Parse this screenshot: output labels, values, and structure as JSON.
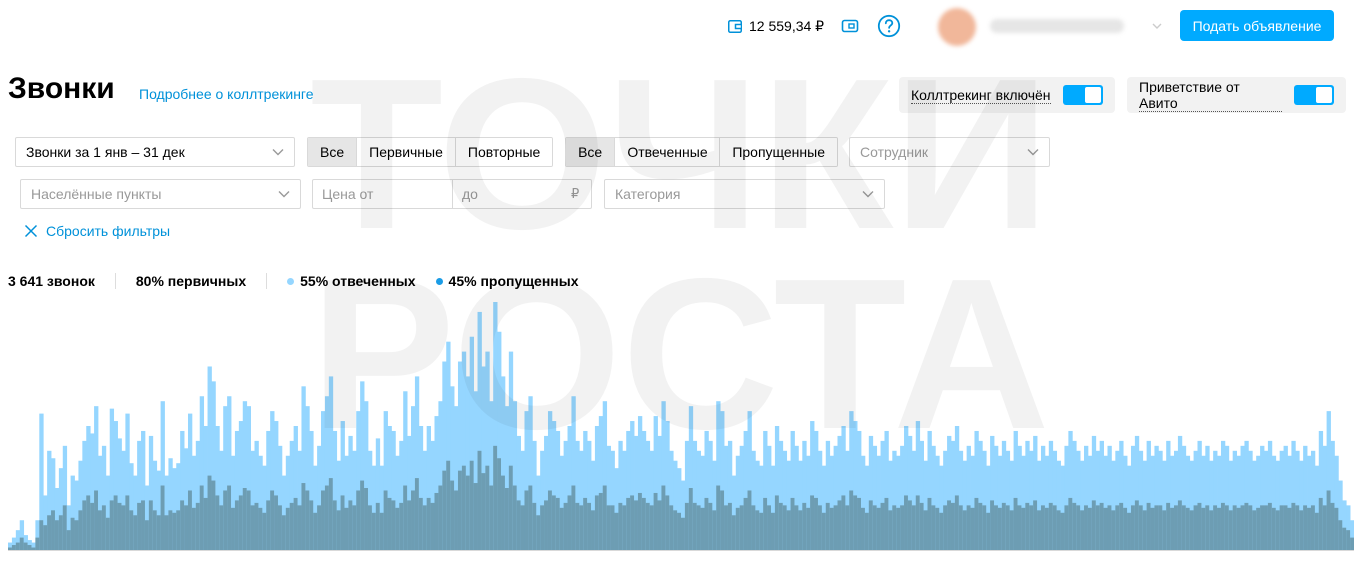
{
  "header": {
    "balance": "12 559,34 ₽",
    "post_button": "Подать объявление",
    "wallet_icon": "wallet-icon",
    "promo_icon": "promo-icon",
    "help_icon": "help-icon"
  },
  "page": {
    "title": "Звонки",
    "more_link": "Подробнее о коллтрекинге"
  },
  "toggles": [
    {
      "label": "Коллтрекинг включён",
      "on": true
    },
    {
      "label": "Приветствие от Авито",
      "on": true
    }
  ],
  "filters": {
    "period": "Звонки за 1 янв – 31 дек",
    "type_segment": [
      "Все",
      "Первичные",
      "Повторные"
    ],
    "status_segment": [
      "Все",
      "Отвеченные",
      "Пропущенные"
    ],
    "employee_placeholder": "Сотрудник",
    "cities_placeholder": "Населённые пункты",
    "price_from_placeholder": "Цена от",
    "price_to_placeholder": "до",
    "currency": "₽",
    "category_placeholder": "Категория",
    "reset": "Сбросить фильтры"
  },
  "stats": {
    "total": "3 641 звонок",
    "primary": "80% первичных",
    "answered": "55% отвеченных",
    "missed": "45% пропущенных"
  },
  "watermark": {
    "line1": "ТОЧКИ",
    "line2": "РОСТА"
  },
  "colors": {
    "accent": "#00aaff",
    "link": "#0091d9",
    "answered": "#95d6ff",
    "missed": "#1a9ce6",
    "missed_bar": "#6d9db3"
  },
  "chart_data": {
    "type": "bar",
    "stacked": true,
    "x_range": "1 янв – 31 дек",
    "series": [
      {
        "name": "55% отвеченных"
      },
      {
        "name": "45% пропущенных"
      }
    ],
    "total": [
      3,
      5,
      8,
      12,
      6,
      4,
      3,
      12,
      55,
      22,
      40,
      37,
      25,
      33,
      42,
      18,
      30,
      28,
      36,
      44,
      50,
      47,
      58,
      38,
      42,
      30,
      57,
      52,
      45,
      40,
      55,
      35,
      30,
      44,
      48,
      26,
      46,
      36,
      32,
      60,
      30,
      37,
      33,
      35,
      48,
      41,
      55,
      38,
      44,
      62,
      50,
      74,
      68,
      50,
      40,
      58,
      62,
      38,
      48,
      52,
      60,
      58,
      40,
      44,
      38,
      34,
      48,
      56,
      52,
      42,
      30,
      38,
      44,
      50,
      40,
      66,
      58,
      48,
      34,
      42,
      56,
      62,
      70,
      48,
      36,
      52,
      38,
      46,
      40,
      56,
      68,
      60,
      40,
      34,
      45,
      34,
      56,
      50,
      48,
      38,
      44,
      64,
      46,
      58,
      70,
      50,
      40,
      50,
      44,
      54,
      60,
      76,
      84,
      66,
      58,
      76,
      80,
      70,
      86,
      64,
      96,
      74,
      80,
      60,
      100,
      88,
      70,
      58,
      80,
      60,
      46,
      40,
      56,
      62,
      44,
      30,
      40,
      46,
      56,
      52,
      48,
      38,
      44,
      50,
      62,
      44,
      40,
      48,
      44,
      36,
      50,
      54,
      60,
      42,
      40,
      33,
      44,
      40,
      48,
      52,
      46,
      54,
      48,
      44,
      40,
      54,
      46,
      60,
      52,
      40,
      36,
      33,
      28,
      44,
      58,
      44,
      40,
      38,
      48,
      44,
      36,
      60,
      56,
      42,
      44,
      30,
      38,
      42,
      48,
      56,
      40,
      36,
      34,
      48,
      42,
      34,
      50,
      44,
      40,
      36,
      48,
      42,
      36,
      44,
      38,
      52,
      48,
      40,
      34,
      44,
      38,
      42,
      46,
      50,
      40,
      56,
      52,
      48,
      38,
      34,
      46,
      42,
      38,
      44,
      48,
      36,
      40,
      38,
      42,
      50,
      46,
      40,
      52,
      44,
      36,
      48,
      42,
      38,
      34,
      40,
      46,
      44,
      50,
      40,
      36,
      42,
      38,
      48,
      44,
      40,
      34,
      46,
      42,
      38,
      44,
      40,
      36,
      48,
      42,
      38,
      44,
      40,
      46,
      36,
      42,
      38,
      44,
      40,
      36,
      34,
      42,
      48,
      44,
      40,
      36,
      42,
      38,
      46,
      40,
      44,
      38,
      42,
      36,
      40,
      44,
      38,
      34,
      42,
      46,
      40,
      36,
      44,
      38,
      42,
      40,
      36,
      44,
      38,
      40,
      46,
      42,
      38,
      36,
      40,
      44,
      38,
      42,
      36,
      40,
      38,
      44,
      42,
      36,
      40,
      38,
      42,
      44,
      40,
      36,
      38,
      42,
      40,
      44,
      38,
      36,
      40,
      42,
      38,
      44,
      40,
      36,
      42,
      38,
      40,
      34,
      48,
      42,
      56,
      44,
      38,
      28,
      20,
      18,
      12
    ],
    "missed": [
      1,
      2,
      3,
      5,
      3,
      2,
      1,
      5,
      12,
      10,
      14,
      16,
      12,
      14,
      18,
      8,
      13,
      12,
      16,
      20,
      22,
      19,
      24,
      16,
      18,
      13,
      20,
      22,
      19,
      18,
      22,
      16,
      14,
      19,
      20,
      12,
      20,
      16,
      14,
      26,
      14,
      16,
      15,
      16,
      20,
      18,
      24,
      17,
      19,
      26,
      21,
      30,
      28,
      22,
      18,
      24,
      26,
      17,
      20,
      22,
      25,
      24,
      18,
      19,
      17,
      15,
      20,
      24,
      22,
      18,
      14,
      17,
      19,
      21,
      18,
      27,
      24,
      20,
      15,
      18,
      24,
      26,
      29,
      20,
      16,
      22,
      17,
      20,
      18,
      24,
      28,
      25,
      18,
      15,
      19,
      15,
      24,
      21,
      20,
      17,
      19,
      26,
      20,
      24,
      29,
      21,
      18,
      21,
      19,
      23,
      26,
      32,
      36,
      28,
      24,
      32,
      34,
      30,
      36,
      27,
      40,
      31,
      34,
      26,
      42,
      37,
      30,
      25,
      34,
      26,
      20,
      18,
      24,
      26,
      19,
      14,
      18,
      20,
      24,
      22,
      21,
      17,
      19,
      22,
      26,
      19,
      18,
      21,
      19,
      16,
      22,
      23,
      26,
      18,
      18,
      15,
      19,
      18,
      21,
      22,
      20,
      23,
      21,
      19,
      18,
      23,
      20,
      26,
      22,
      18,
      16,
      15,
      13,
      19,
      25,
      19,
      18,
      17,
      21,
      19,
      16,
      26,
      24,
      18,
      19,
      14,
      17,
      18,
      21,
      24,
      18,
      16,
      15,
      21,
      18,
      15,
      22,
      19,
      18,
      16,
      21,
      18,
      16,
      19,
      17,
      22,
      21,
      18,
      15,
      19,
      17,
      18,
      20,
      22,
      18,
      24,
      22,
      21,
      17,
      15,
      20,
      18,
      17,
      19,
      21,
      16,
      18,
      17,
      18,
      22,
      20,
      18,
      22,
      19,
      16,
      21,
      18,
      17,
      15,
      18,
      20,
      19,
      22,
      18,
      16,
      18,
      17,
      21,
      19,
      18,
      15,
      20,
      18,
      17,
      19,
      18,
      16,
      21,
      18,
      17,
      19,
      18,
      20,
      16,
      18,
      17,
      19,
      18,
      16,
      15,
      18,
      21,
      19,
      18,
      16,
      18,
      17,
      20,
      18,
      19,
      17,
      18,
      16,
      18,
      19,
      17,
      15,
      18,
      20,
      18,
      16,
      19,
      17,
      18,
      18,
      16,
      19,
      17,
      18,
      20,
      18,
      17,
      16,
      18,
      19,
      17,
      18,
      16,
      18,
      17,
      19,
      18,
      16,
      18,
      17,
      18,
      19,
      18,
      16,
      17,
      18,
      18,
      19,
      17,
      16,
      18,
      18,
      17,
      19,
      18,
      16,
      18,
      17,
      18,
      15,
      21,
      18,
      24,
      19,
      17,
      12,
      9,
      8,
      5
    ]
  }
}
